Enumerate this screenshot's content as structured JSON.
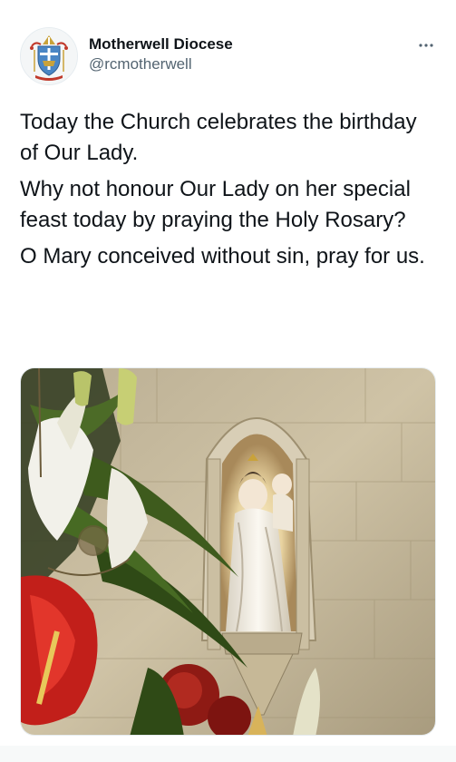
{
  "tweet": {
    "author": {
      "display_name": "Motherwell Diocese",
      "handle": "@rcmotherwell",
      "avatar_icon": "diocese-crest-icon"
    },
    "more_icon": "more-options-icon",
    "paragraphs": [
      "Today the Church celebrates the birthday of Our Lady.",
      "Why not honour Our Lady on her special feast today by praying the Holy Rosary?",
      "O Mary conceived without sin, pray for us."
    ],
    "media_icon": "statue-photo"
  },
  "colors": {
    "text": "#0f1419",
    "secondary_text": "#536471",
    "crest_blue": "#4a86c5",
    "crest_gold": "#c9a23a",
    "crest_red": "#c0392b"
  }
}
